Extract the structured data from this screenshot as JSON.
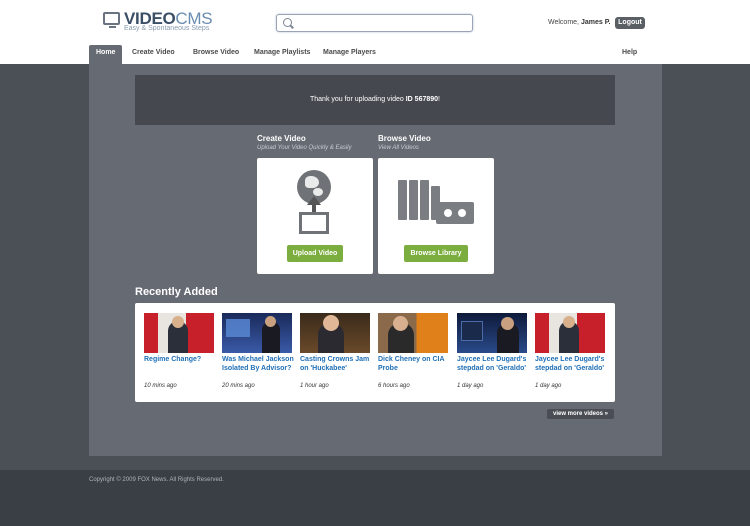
{
  "brand": {
    "name_bold": "VIDEO",
    "name_light": "CMS",
    "tagline": "Easy & Spontaneous Steps"
  },
  "search": {
    "placeholder": ""
  },
  "header": {
    "welcome_prefix": "Welcome,",
    "user_name": "James P.",
    "logout_label": "Logout"
  },
  "nav": {
    "tabs": [
      "Home",
      "Create Video",
      "Browse Video",
      "Manage Playlists",
      "Manage Players"
    ],
    "active": "Home",
    "help": "Help"
  },
  "notice": {
    "prefix": "Thank you for uploading video",
    "video_id": "ID 567890",
    "suffix": "!"
  },
  "create": {
    "title": "Create Video",
    "subtitle": "Upload Your Video Quickly & Easily",
    "button": "Upload Video"
  },
  "browse": {
    "title": "Browse Video",
    "subtitle": "View All Videos",
    "button": "Browse Library"
  },
  "recent": {
    "title": "Recently Added",
    "videos": [
      {
        "title": "Regime Change?",
        "time": "10 mins ago"
      },
      {
        "title": "Was Michael Jackson Isolated By Advisor?",
        "time": "20 mins ago"
      },
      {
        "title": "Casting Crowns Jam on 'Huckabee'",
        "time": "1 hour ago"
      },
      {
        "title": "Dick Cheney on CIA Probe",
        "time": "6 hours ago"
      },
      {
        "title": "Jaycee Lee Dugard's stepdad on 'Geraldo'",
        "time": "1 day ago"
      },
      {
        "title": "Jaycee Lee Dugard's stepdad on 'Geraldo'",
        "time": "1 day ago"
      }
    ],
    "more_label": "view more videos »"
  },
  "footer": {
    "copyright": "Copyright © 2009 FOX News. All Rights Reserved."
  }
}
